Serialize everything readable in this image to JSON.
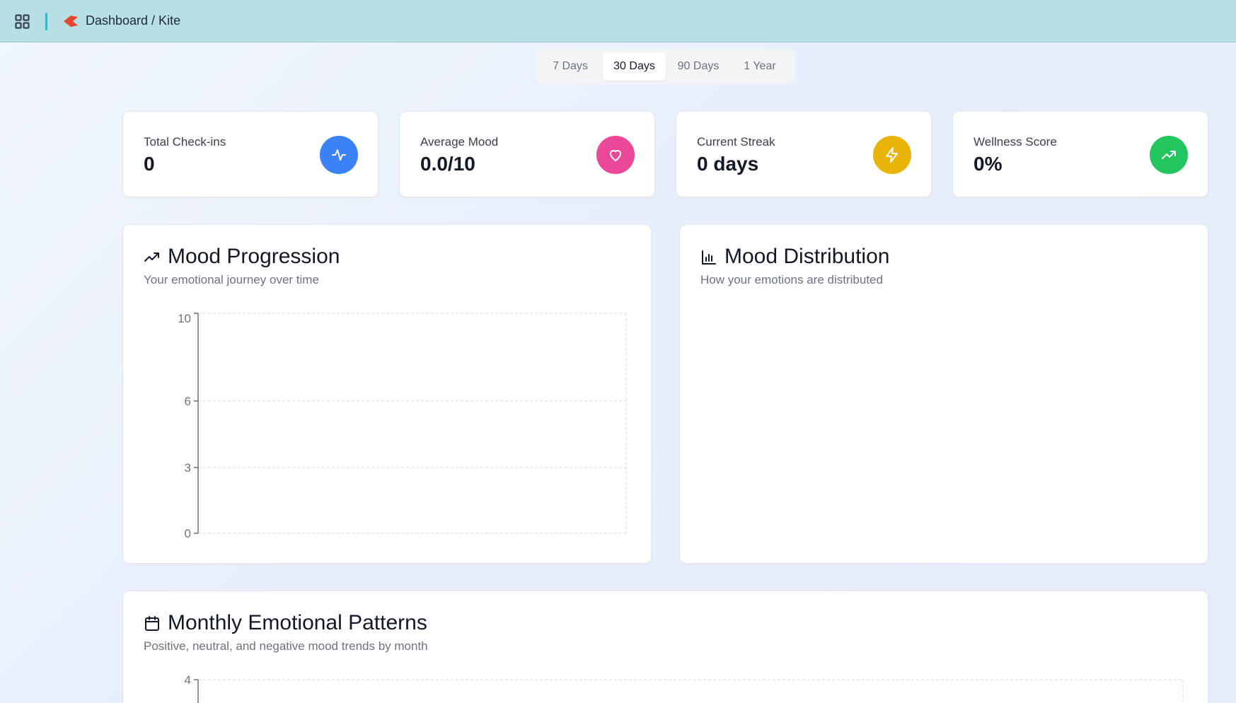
{
  "header": {
    "breadcrumb": "Dashboard / Kite",
    "grid_icon": "grid-icon",
    "logo_icon": "kite-logo-icon",
    "accent": "#3fb3c1",
    "background": "#b8e0e4"
  },
  "range_tabs": {
    "items": [
      {
        "label": "7 Days",
        "active": false
      },
      {
        "label": "30 Days",
        "active": true
      },
      {
        "label": "90 Days",
        "active": false
      },
      {
        "label": "1 Year",
        "active": false
      }
    ]
  },
  "stats": [
    {
      "label": "Total Check-ins",
      "value": "0",
      "icon": "activity-icon",
      "color": "#3b82f6"
    },
    {
      "label": "Average Mood",
      "value": "0.0/10",
      "icon": "heart-icon",
      "color": "#ec4899"
    },
    {
      "label": "Current Streak",
      "value": "0 days",
      "icon": "zap-icon",
      "color": "#eab308"
    },
    {
      "label": "Wellness Score",
      "value": "0%",
      "icon": "trending-up-icon",
      "color": "#22c55e"
    }
  ],
  "mood_progression": {
    "title": "Mood Progression",
    "subtitle": "Your emotional journey over time",
    "icon": "trending-up-icon",
    "chart_data": {
      "type": "line",
      "x": [],
      "series": [],
      "ylim": [
        0,
        10
      ],
      "yticks": [
        "10",
        "6",
        "3",
        "0"
      ],
      "grid": true
    }
  },
  "mood_distribution": {
    "title": "Mood Distribution",
    "subtitle": "How your emotions are distributed",
    "icon": "bar-chart-icon"
  },
  "monthly_patterns": {
    "title": "Monthly Emotional Patterns",
    "subtitle": "Positive, neutral, and negative mood trends by month",
    "icon": "calendar-icon",
    "chart_data": {
      "type": "bar",
      "categories": [],
      "series": [],
      "yticks": [
        "4"
      ],
      "grid": true
    }
  }
}
